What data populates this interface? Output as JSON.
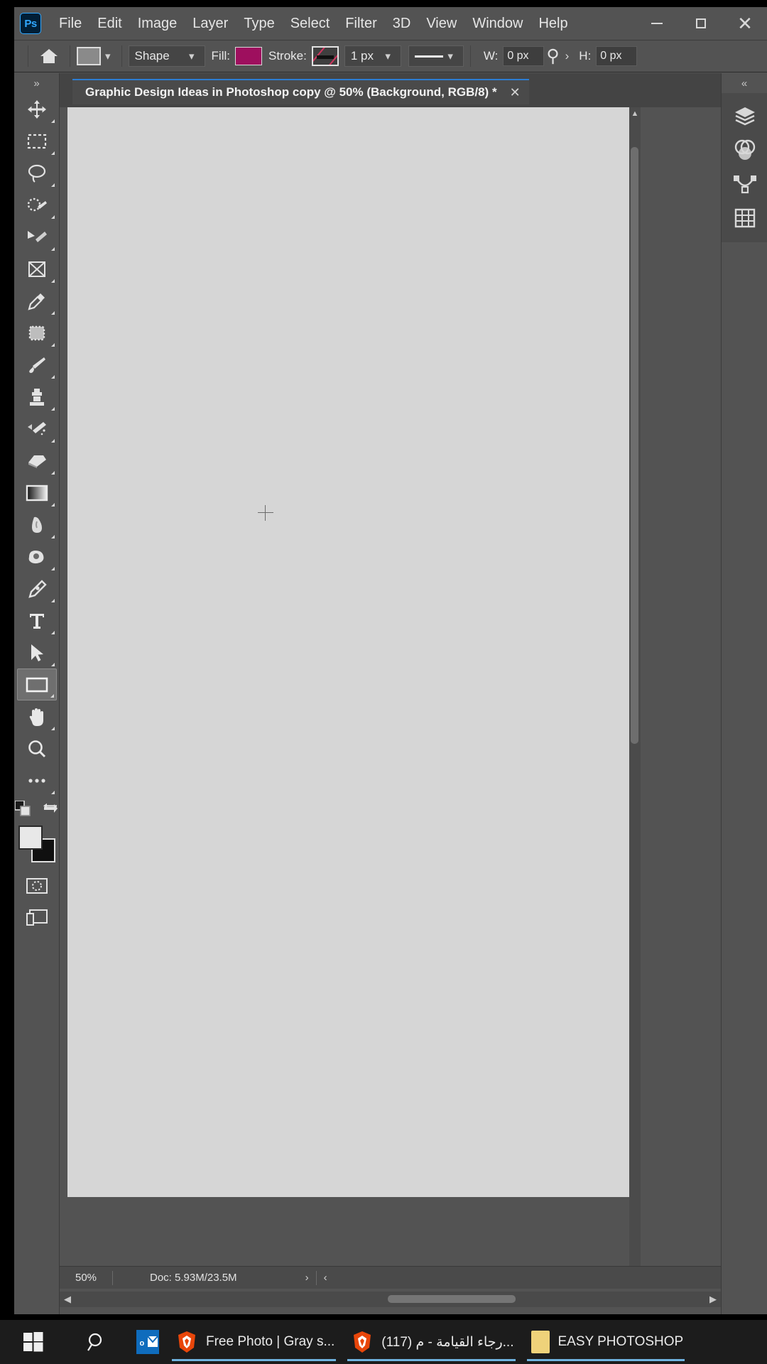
{
  "app": {
    "name": "Adobe Photoshop",
    "logo_text": "Ps"
  },
  "menubar": {
    "items": [
      {
        "label": "File"
      },
      {
        "label": "Edit"
      },
      {
        "label": "Image"
      },
      {
        "label": "Layer"
      },
      {
        "label": "Type"
      },
      {
        "label": "Select"
      },
      {
        "label": "Filter"
      },
      {
        "label": "3D"
      },
      {
        "label": "View"
      },
      {
        "label": "Window"
      },
      {
        "label": "Help"
      }
    ],
    "window_controls": {
      "minimize": "—",
      "maximize": "□",
      "close": "✕"
    }
  },
  "options_bar": {
    "home_icon": "home-icon",
    "tool_preset_label": "shape-preset-swatch",
    "shape_mode": "Shape",
    "fill_label": "Fill:",
    "fill_color": "#9e0f5e",
    "stroke_label": "Stroke:",
    "stroke_color": "#3f3f3f",
    "stroke_width": "1 px",
    "stroke_style": "solid-line",
    "width_label": "W:",
    "width_value": "0 px",
    "link_icon": "›",
    "height_label": "H:",
    "height_value": "0 px",
    "search_icon": "search-icon"
  },
  "document": {
    "tab_title": "Graphic Design Ideas in Photoshop copy @ 50% (Background, RGB/8) *",
    "close_glyph": "✕"
  },
  "toolbar": {
    "expand_glyph": "»",
    "tools": [
      {
        "name": "move-tool",
        "icon": "move"
      },
      {
        "name": "rectangular-marquee-tool",
        "icon": "marquee"
      },
      {
        "name": "lasso-tool",
        "icon": "lasso"
      },
      {
        "name": "object-selection-tool",
        "icon": "quick-select"
      },
      {
        "name": "magic-wand-tool",
        "icon": "wand"
      },
      {
        "name": "crop-tool",
        "icon": "frame"
      },
      {
        "name": "eyedropper-tool",
        "icon": "eyedropper"
      },
      {
        "name": "spot-healing-brush-tool",
        "icon": "healing"
      },
      {
        "name": "brush-tool",
        "icon": "brush"
      },
      {
        "name": "clone-stamp-tool",
        "icon": "stamp"
      },
      {
        "name": "history-brush-tool",
        "icon": "history-brush"
      },
      {
        "name": "eraser-tool",
        "icon": "eraser"
      },
      {
        "name": "gradient-tool",
        "icon": "gradient"
      },
      {
        "name": "blur-tool",
        "icon": "blur"
      },
      {
        "name": "dodge-tool",
        "icon": "dodge"
      },
      {
        "name": "pen-tool",
        "icon": "pen"
      },
      {
        "name": "horizontal-type-tool",
        "icon": "type"
      },
      {
        "name": "path-selection-tool",
        "icon": "arrow"
      },
      {
        "name": "rectangle-tool",
        "icon": "rectangle",
        "active": true
      },
      {
        "name": "hand-tool",
        "icon": "hand"
      },
      {
        "name": "zoom-tool",
        "icon": "zoom"
      },
      {
        "name": "edit-toolbar-tool",
        "icon": "ellipsis"
      }
    ],
    "default_colors_icon": "default-colors-icon",
    "swap_colors_icon": "swap-colors-icon",
    "foreground_color": "#e8e8e8",
    "background_color": "#101010",
    "quick_mask_icon": "quick-mask-icon",
    "screen_mode_icon": "screen-mode-icon"
  },
  "right_panel": {
    "collapse_glyph": "«",
    "items": [
      {
        "name": "layers-panel-icon",
        "label": "Layers"
      },
      {
        "name": "adjustments-panel-icon",
        "label": "Adjustments"
      },
      {
        "name": "paths-panel-icon",
        "label": "Paths"
      },
      {
        "name": "properties-panel-icon",
        "label": "Properties"
      }
    ]
  },
  "status_bar": {
    "zoom": "50%",
    "doc_info": "Doc: 5.93M/23.5M",
    "next_arrow": "›",
    "prev_arrow": "‹"
  },
  "taskbar": {
    "start_icon": "windows-start-icon",
    "search_icon": "search-icon",
    "items": [
      {
        "name": "taskbar-outlook",
        "icon": "outlook-icon",
        "title": ""
      },
      {
        "name": "taskbar-brave-1",
        "icon": "brave-icon",
        "title": "Free Photo | Gray s...",
        "active": true
      },
      {
        "name": "taskbar-brave-2",
        "icon": "brave-icon",
        "title": "رجاء القيامة - م (117)...",
        "active": true
      },
      {
        "name": "taskbar-explorer",
        "icon": "folder-icon",
        "title": "EASY PHOTOSHOP",
        "active": true
      }
    ]
  }
}
